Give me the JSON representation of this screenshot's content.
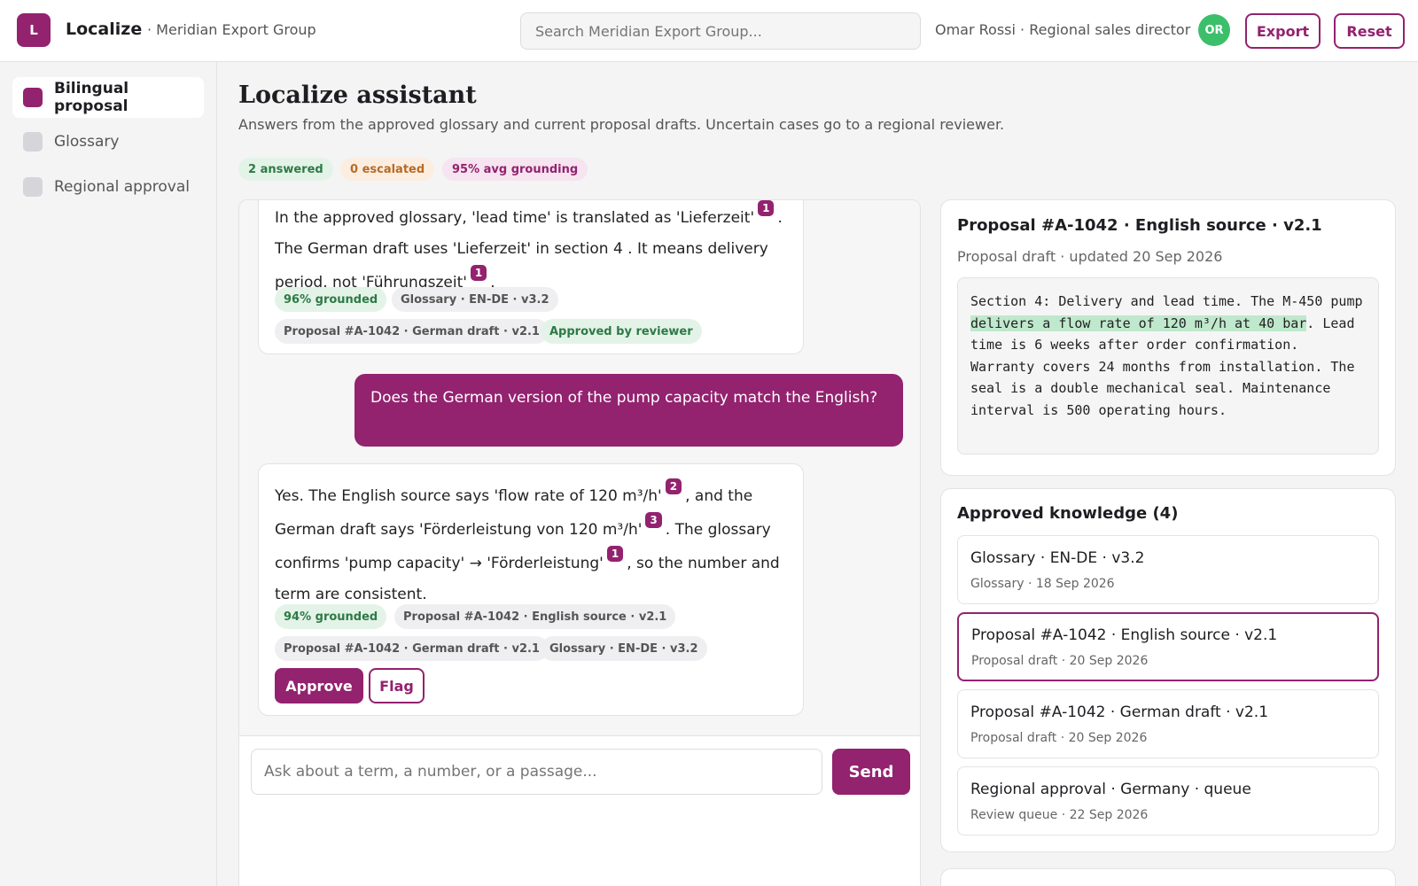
{
  "app": {
    "logo_letter": "L",
    "name": "Localize",
    "org": "· Meridian Export Group",
    "search_placeholder": "Search Meridian Export Group...",
    "user": "Omar Rossi · Regional sales director",
    "avatar_initials": "OR",
    "export_label": "Export",
    "reset_label": "Reset"
  },
  "sidebar": {
    "items": [
      {
        "label": "Bilingual proposal",
        "active": true
      },
      {
        "label": "Glossary",
        "active": false
      },
      {
        "label": "Regional approval",
        "active": false
      }
    ]
  },
  "main": {
    "title": "Localize assistant",
    "subtitle": "Answers from the approved glossary and current proposal drafts. Uncertain cases go to a regional reviewer.",
    "badges": {
      "answered": "2 answered",
      "escalated": "0 escalated",
      "grounding": "95% avg grounding"
    }
  },
  "chat": {
    "msg1": {
      "p1": "In the approved glossary, 'lead time' is translated as 'Lieferzeit'",
      "c1": "1",
      "p2": ". The German draft uses 'Lieferzeit' in section 4 . It means delivery period, not 'Führungszeit'",
      "c2": "1",
      "p3": ".",
      "chip_grounded": "96% grounded",
      "chip_src1": "Glossary · EN-DE · v3.2",
      "chip_src2": "Proposal #A-1042 · German draft · v2.1",
      "chip_approved": "Approved by reviewer"
    },
    "user_msg": "Does the German version of the pump capacity match the English?",
    "msg2": {
      "p1": "Yes. The English source says 'flow rate of 120 m³/h'",
      "c1": "2",
      "p2": ", and the German draft says 'Förderleistung von 120 m³/h'",
      "c2": "3",
      "p3": ". The glossary confirms 'pump capacity' → 'Förderleistung'",
      "c3": "1",
      "p4": ", so the number and term are consistent.",
      "chip_grounded": "94% grounded",
      "chip_src1": "Proposal #A-1042 · English source · v2.1",
      "chip_src2": "Proposal #A-1042 · German draft · v2.1",
      "chip_src3": "Glossary · EN-DE · v3.2",
      "approve_label": "Approve",
      "flag_label": "Flag"
    },
    "input_placeholder": "Ask about a term, a number, or a passage...",
    "send_label": "Send"
  },
  "source_card": {
    "title": "Proposal #A-1042 · English source · v2.1",
    "meta": "Proposal draft · updated 20 Sep 2026",
    "text_before": "Section 4: Delivery and lead time. The M-450 pump ",
    "text_highlight": "delivers a flow rate of 120 m³/h at 40 bar",
    "text_after": ". Lead time is 6 weeks after order confirmation. Warranty covers 24 months from installation. The seal is a double mechanical seal. Maintenance interval is 500 operating hours."
  },
  "knowledge": {
    "title": "Approved knowledge (4)",
    "items": [
      {
        "title": "Glossary · EN-DE · v3.2",
        "meta": "Glossary · 18 Sep 2026"
      },
      {
        "title": "Proposal #A-1042 · English source · v2.1",
        "meta": "Proposal draft · 20 Sep 2026"
      },
      {
        "title": "Proposal #A-1042 · German draft · v2.1",
        "meta": "Proposal draft · 20 Sep 2026"
      },
      {
        "title": "Regional approval · Germany · queue",
        "meta": "Review queue · 22 Sep 2026"
      }
    ]
  },
  "colors": {
    "accent": "#93226f",
    "success": "#3cbf6a",
    "highlight": "#bfe8cc"
  }
}
